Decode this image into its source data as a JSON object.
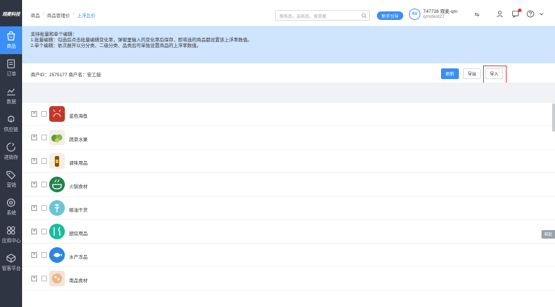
{
  "app": {
    "logo": "观麦科技"
  },
  "sidebar": {
    "items": [
      {
        "label": "商品",
        "icon": "shopping-bag-icon",
        "active": true
      },
      {
        "label": "订单",
        "icon": "order-icon"
      },
      {
        "label": "数据",
        "icon": "chart-icon"
      },
      {
        "label": "供应链",
        "icon": "supply-chain-icon"
      },
      {
        "label": "进销存",
        "icon": "inventory-icon"
      },
      {
        "label": "营销",
        "icon": "tag-icon"
      },
      {
        "label": "系统",
        "icon": "settings-icon"
      },
      {
        "label": "应用中心",
        "icon": "app-center-icon"
      },
      {
        "label": "管客平台",
        "icon": "platform-icon"
      }
    ]
  },
  "header": {
    "breadcrumb": [
      "商品",
      "商品管理价",
      "上浮比价"
    ],
    "search_placeholder": "搜商品，选商品，搜单据",
    "plan_button": "新手引导",
    "account_avatar": "AV",
    "account_name": "T47726 观麦-qm",
    "account_sub": "qmstest27",
    "swap_symbol": "⇆"
  },
  "notice": {
    "title": "支持批量和单个编辑：",
    "line1": "1.批量编辑：勾选后点击批量编辑变化率，弹窗里输入的变化率后保存，即将选的商品都设置该上浮率数值。",
    "line2": "2.单个编辑：依次展开以分分类、二级分类、品类后可单独设置商品的上浮率数值。"
  },
  "merchant": {
    "text": "商户ID：2575177   商户名：安工授",
    "btn_primary": "刷新",
    "btn_export": "导出",
    "btn_import": "导入"
  },
  "side_tab": "帮助",
  "categories": [
    {
      "name": "蓝色海鱼",
      "icon": "seafood-icon",
      "color": "#c0392b"
    },
    {
      "name": "蔬菜水果",
      "icon": "vegetable-icon",
      "color": "#f2f0e6"
    },
    {
      "name": "调味用品",
      "icon": "condiment-icon",
      "color": "#f5efe2"
    },
    {
      "name": "火锅食材",
      "icon": "hotpot-icon",
      "color": "#1e8449"
    },
    {
      "name": "粮油干货",
      "icon": "grain-icon",
      "color": "#6cc3d5"
    },
    {
      "name": "厨房用品",
      "icon": "kitchen-icon",
      "color": "#1abc9c"
    },
    {
      "name": "水产冻品",
      "icon": "frozen-icon",
      "color": "#2e86de"
    },
    {
      "name": "南品食材",
      "icon": "food-icon",
      "color": "#f6e3d3"
    }
  ]
}
